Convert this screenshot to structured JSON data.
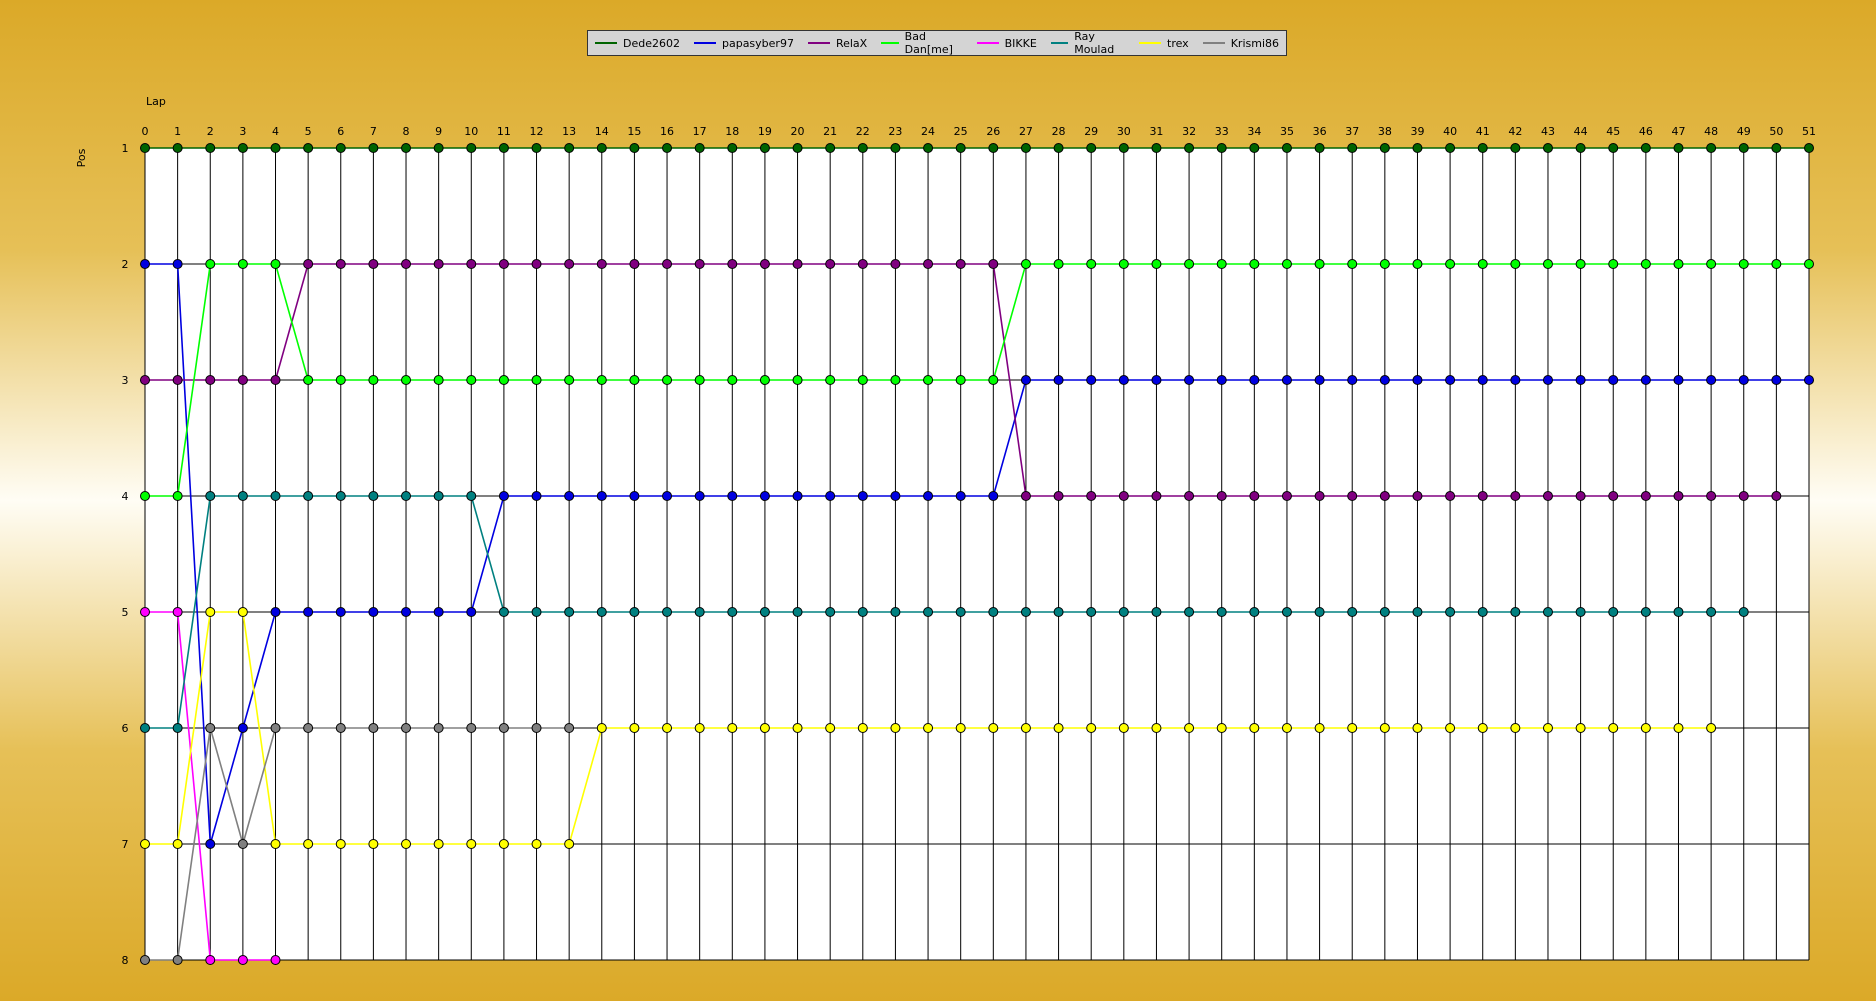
{
  "chart_data": {
    "type": "line",
    "xlabel": "Lap",
    "ylabel": "Pos",
    "x": [
      0,
      1,
      2,
      3,
      4,
      5,
      6,
      7,
      8,
      9,
      10,
      11,
      12,
      13,
      14,
      15,
      16,
      17,
      18,
      19,
      20,
      21,
      22,
      23,
      24,
      25,
      26,
      27,
      28,
      29,
      30,
      31,
      32,
      33,
      34,
      35,
      36,
      37,
      38,
      39,
      40,
      41,
      42,
      43,
      44,
      45,
      46,
      47,
      48,
      49,
      50,
      51
    ],
    "y_ticks": [
      1,
      2,
      3,
      4,
      5,
      6,
      7,
      8
    ],
    "ylim": [
      1,
      8
    ],
    "xlim": [
      0,
      51
    ],
    "y_inverted": true,
    "grid": true,
    "legend_position": "top-center",
    "series": [
      {
        "name": "Dede2602",
        "color": "#006400",
        "values": [
          1,
          1,
          1,
          1,
          1,
          1,
          1,
          1,
          1,
          1,
          1,
          1,
          1,
          1,
          1,
          1,
          1,
          1,
          1,
          1,
          1,
          1,
          1,
          1,
          1,
          1,
          1,
          1,
          1,
          1,
          1,
          1,
          1,
          1,
          1,
          1,
          1,
          1,
          1,
          1,
          1,
          1,
          1,
          1,
          1,
          1,
          1,
          1,
          1,
          1,
          1,
          1
        ]
      },
      {
        "name": "papasyber97",
        "color": "#0000e0",
        "values": [
          2,
          2,
          7,
          6,
          5,
          5,
          5,
          5,
          5,
          5,
          5,
          4,
          4,
          4,
          4,
          4,
          4,
          4,
          4,
          4,
          4,
          4,
          4,
          4,
          4,
          4,
          4,
          3,
          3,
          3,
          3,
          3,
          3,
          3,
          3,
          3,
          3,
          3,
          3,
          3,
          3,
          3,
          3,
          3,
          3,
          3,
          3,
          3,
          3,
          3,
          3,
          3
        ]
      },
      {
        "name": "RelaX",
        "color": "#800080",
        "values": [
          3,
          3,
          3,
          3,
          3,
          2,
          2,
          2,
          2,
          2,
          2,
          2,
          2,
          2,
          2,
          2,
          2,
          2,
          2,
          2,
          2,
          2,
          2,
          2,
          2,
          2,
          2,
          4,
          4,
          4,
          4,
          4,
          4,
          4,
          4,
          4,
          4,
          4,
          4,
          4,
          4,
          4,
          4,
          4,
          4,
          4,
          4,
          4,
          4,
          4,
          4
        ]
      },
      {
        "name": "Bad Dan[me]",
        "color": "#00ff00",
        "values": [
          4,
          4,
          2,
          2,
          2,
          3,
          3,
          3,
          3,
          3,
          3,
          3,
          3,
          3,
          3,
          3,
          3,
          3,
          3,
          3,
          3,
          3,
          3,
          3,
          3,
          3,
          3,
          2,
          2,
          2,
          2,
          2,
          2,
          2,
          2,
          2,
          2,
          2,
          2,
          2,
          2,
          2,
          2,
          2,
          2,
          2,
          2,
          2,
          2,
          2,
          2,
          2
        ]
      },
      {
        "name": "BIKKE",
        "color": "#ff00ff",
        "values": [
          5,
          5,
          8,
          8,
          8
        ]
      },
      {
        "name": "Ray Moulad",
        "color": "#008080",
        "values": [
          6,
          6,
          4,
          4,
          4,
          4,
          4,
          4,
          4,
          4,
          4,
          5,
          5,
          5,
          5,
          5,
          5,
          5,
          5,
          5,
          5,
          5,
          5,
          5,
          5,
          5,
          5,
          5,
          5,
          5,
          5,
          5,
          5,
          5,
          5,
          5,
          5,
          5,
          5,
          5,
          5,
          5,
          5,
          5,
          5,
          5,
          5,
          5,
          5,
          5
        ]
      },
      {
        "name": "trex",
        "color": "#ffff00",
        "values": [
          7,
          7,
          5,
          5,
          7,
          7,
          7,
          7,
          7,
          7,
          7,
          7,
          7,
          7,
          6,
          6,
          6,
          6,
          6,
          6,
          6,
          6,
          6,
          6,
          6,
          6,
          6,
          6,
          6,
          6,
          6,
          6,
          6,
          6,
          6,
          6,
          6,
          6,
          6,
          6,
          6,
          6,
          6,
          6,
          6,
          6,
          6,
          6,
          6
        ]
      },
      {
        "name": "Krismi86",
        "color": "#808080",
        "values": [
          8,
          8,
          6,
          7,
          6,
          6,
          6,
          6,
          6,
          6,
          6,
          6,
          6,
          6
        ]
      }
    ]
  }
}
